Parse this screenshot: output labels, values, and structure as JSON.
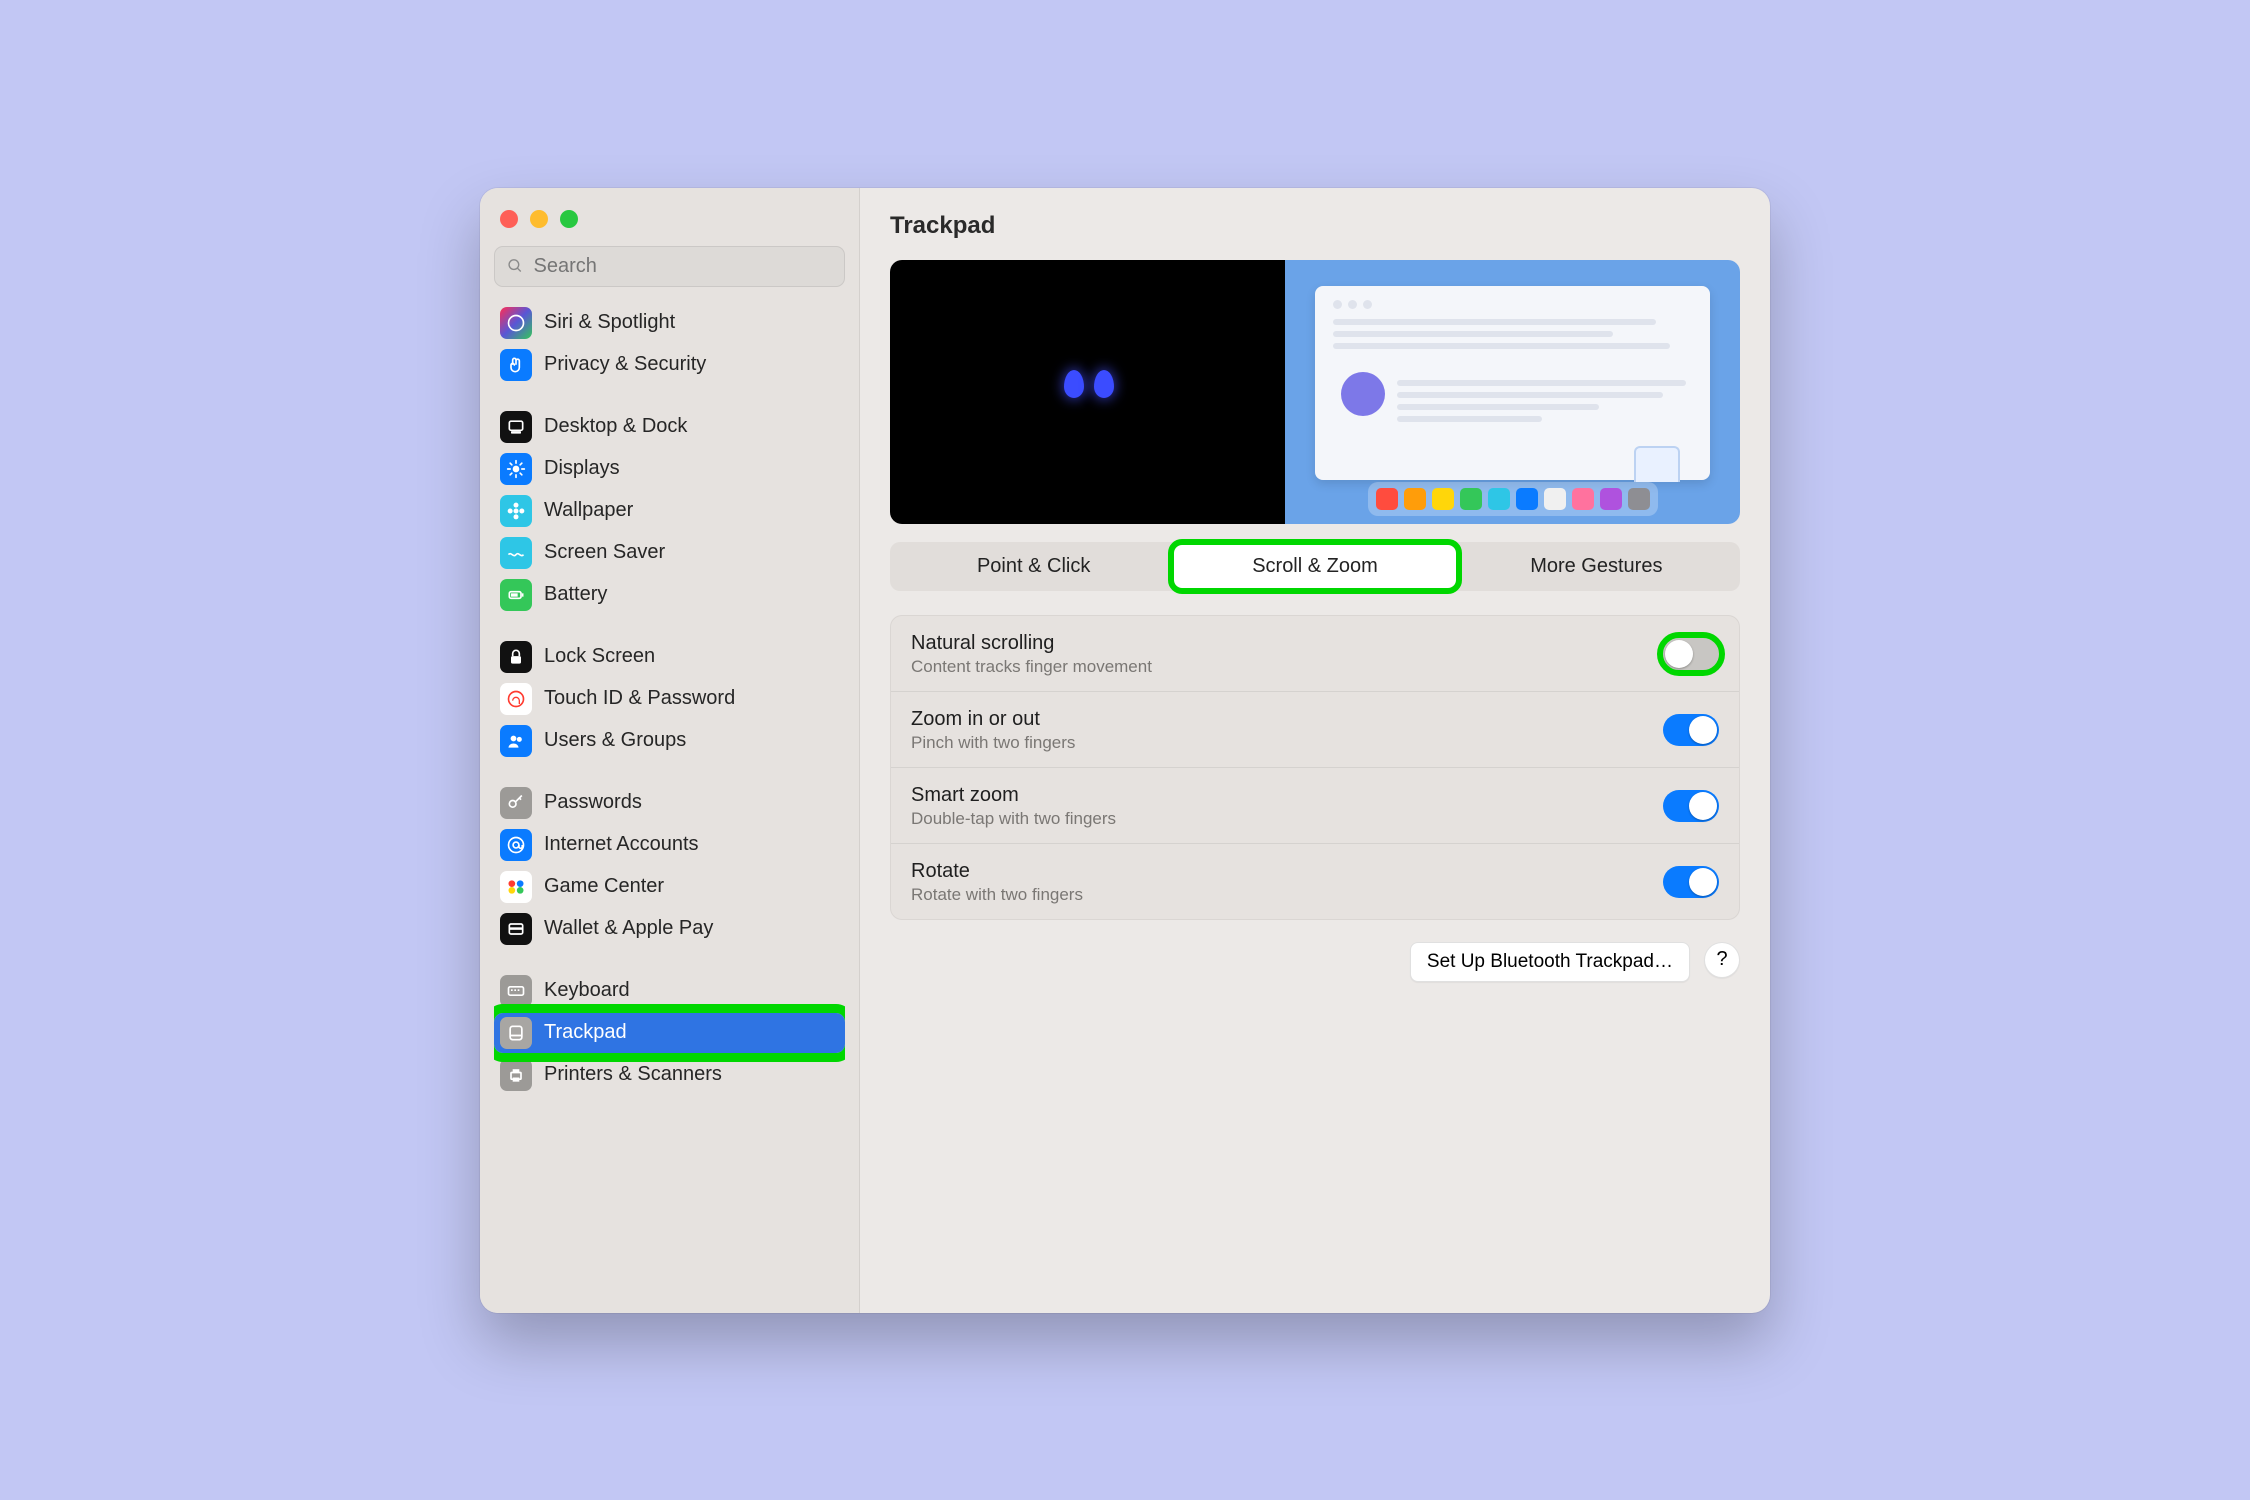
{
  "search": {
    "placeholder": "Search"
  },
  "header": {
    "title": "Trackpad"
  },
  "sidebar": {
    "groups": [
      {
        "items": [
          {
            "label": "Siri & Spotlight",
            "icon": "siri",
            "bg": "linear-gradient(135deg,#ff2d55,#5856d6,#34c759)"
          },
          {
            "label": "Privacy & Security",
            "icon": "hand",
            "bg": "#0a7bff"
          }
        ]
      },
      {
        "items": [
          {
            "label": "Desktop & Dock",
            "icon": "dock",
            "bg": "#111"
          },
          {
            "label": "Displays",
            "icon": "sun",
            "bg": "#0a7bff"
          },
          {
            "label": "Wallpaper",
            "icon": "flower",
            "bg": "#2ec6e6"
          },
          {
            "label": "Screen Saver",
            "icon": "wave",
            "bg": "#2ec6e6"
          },
          {
            "label": "Battery",
            "icon": "batt",
            "bg": "#34c759"
          }
        ]
      },
      {
        "items": [
          {
            "label": "Lock Screen",
            "icon": "lock",
            "bg": "#111"
          },
          {
            "label": "Touch ID & Password",
            "icon": "finger",
            "bg": "#fff"
          },
          {
            "label": "Users & Groups",
            "icon": "users",
            "bg": "#0a7bff"
          }
        ]
      },
      {
        "items": [
          {
            "label": "Passwords",
            "icon": "key",
            "bg": "#9c9a97"
          },
          {
            "label": "Internet Accounts",
            "icon": "at",
            "bg": "#0a7bff"
          },
          {
            "label": "Game Center",
            "icon": "game",
            "bg": "#fff"
          },
          {
            "label": "Wallet & Apple Pay",
            "icon": "wallet",
            "bg": "#111"
          }
        ]
      },
      {
        "items": [
          {
            "label": "Keyboard",
            "icon": "kb",
            "bg": "#9c9a97"
          },
          {
            "label": "Trackpad",
            "icon": "track",
            "bg": "#9c9a97",
            "selected": true,
            "highlight": true
          },
          {
            "label": "Printers & Scanners",
            "icon": "print",
            "bg": "#9c9a97"
          }
        ]
      }
    ]
  },
  "tabs": [
    {
      "label": "Point & Click",
      "selected": false
    },
    {
      "label": "Scroll & Zoom",
      "selected": true,
      "highlight": true
    },
    {
      "label": "More Gestures",
      "selected": false
    }
  ],
  "settings": [
    {
      "title": "Natural scrolling",
      "sub": "Content tracks finger movement",
      "on": false,
      "highlight": true
    },
    {
      "title": "Zoom in or out",
      "sub": "Pinch with two fingers",
      "on": true
    },
    {
      "title": "Smart zoom",
      "sub": "Double-tap with two fingers",
      "on": true
    },
    {
      "title": "Rotate",
      "sub": "Rotate with two fingers",
      "on": true
    }
  ],
  "footer": {
    "setup": "Set Up Bluetooth Trackpad…",
    "help": "?"
  },
  "dock_colors": [
    "#ff4c3e",
    "#ff9d0a",
    "#ffd60a",
    "#34c759",
    "#2ec6e6",
    "#0a7bff",
    "#f0f0f0",
    "#ff729e",
    "#af52de",
    "#8e8e93"
  ]
}
